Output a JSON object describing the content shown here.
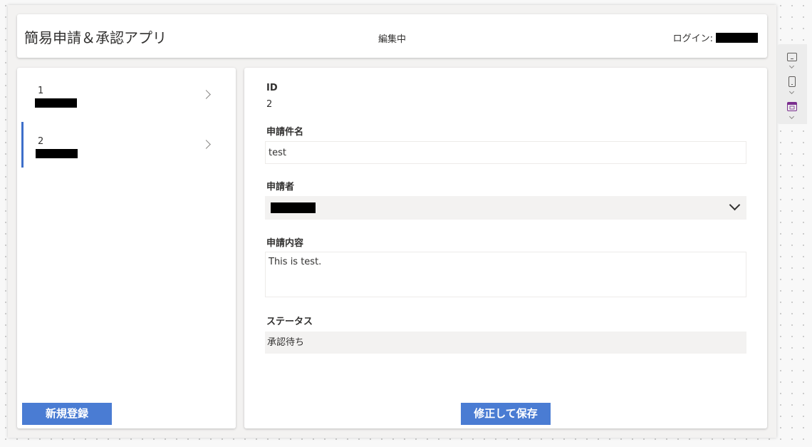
{
  "header": {
    "title": "簡易申請＆承認アプリ",
    "mode": "編集中",
    "login_label": "ログイン:"
  },
  "gallery": {
    "items": [
      {
        "id": "1",
        "selected": false
      },
      {
        "id": "2",
        "selected": true
      }
    ],
    "new_button": "新規登録"
  },
  "form": {
    "id_label": "ID",
    "id_value": "2",
    "title_label": "申請件名",
    "title_value": "test",
    "applicant_label": "申請者",
    "content_label": "申請内容",
    "content_value": "This is test.",
    "status_label": "ステータス",
    "status_value": "承認待ち",
    "save_button": "修正して保存"
  },
  "side_panel": {
    "icons": [
      "tablet-icon",
      "phone-icon",
      "calendar-icon"
    ]
  },
  "colors": {
    "accent": "#4a7cd3",
    "selection_bar": "#3e6fca",
    "canvas": "#f3f2f1"
  }
}
